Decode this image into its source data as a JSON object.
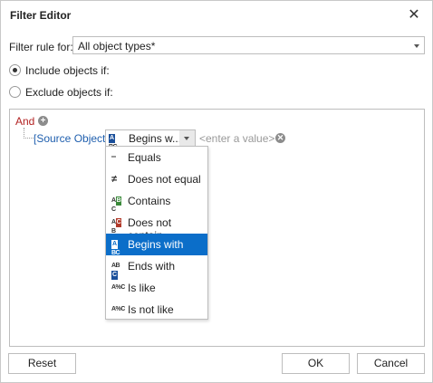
{
  "window": {
    "title": "Filter Editor",
    "close_glyph": "✕"
  },
  "filter_rule": {
    "label": "Filter rule for:",
    "value": "All object types*"
  },
  "include": {
    "label": "Include objects if:",
    "checked": true
  },
  "exclude": {
    "label": "Exclude objects if:",
    "checked": false
  },
  "condition": {
    "group_op": "And",
    "plus_glyph": "+",
    "field": "[Source Object]",
    "operator": "Begins w...",
    "value_placeholder": "<enter a value>",
    "remove_glyph": "✕"
  },
  "operators": [
    {
      "label": "Equals",
      "icon": "equals-icon",
      "glyph": "═"
    },
    {
      "label": "Does not equal",
      "icon": "not-equal-icon",
      "glyph": "≠"
    },
    {
      "label": "Contains",
      "icon": "contains-icon",
      "glyph": "ABC",
      "color": "#3a8a3a"
    },
    {
      "label": "Does not contain",
      "icon": "does-not-contain-icon",
      "glyph": "ACB",
      "color": "#b23a2a"
    },
    {
      "label": "Begins with",
      "icon": "begins-with-icon",
      "glyph": "ABC",
      "color": "#1a4f9a",
      "selected": true
    },
    {
      "label": "Ends with",
      "icon": "ends-with-icon",
      "glyph": "ABC",
      "color": "#1a4f9a"
    },
    {
      "label": "Is like",
      "icon": "is-like-icon",
      "glyph": "A%C"
    },
    {
      "label": "Is not like",
      "icon": "is-not-like-icon",
      "glyph": "A%C"
    }
  ],
  "buttons": {
    "reset": "Reset",
    "ok": "OK",
    "cancel": "Cancel"
  },
  "colors": {
    "accent": "#0b6ec9",
    "group_op": "#b22222",
    "field": "#1f5fae"
  }
}
